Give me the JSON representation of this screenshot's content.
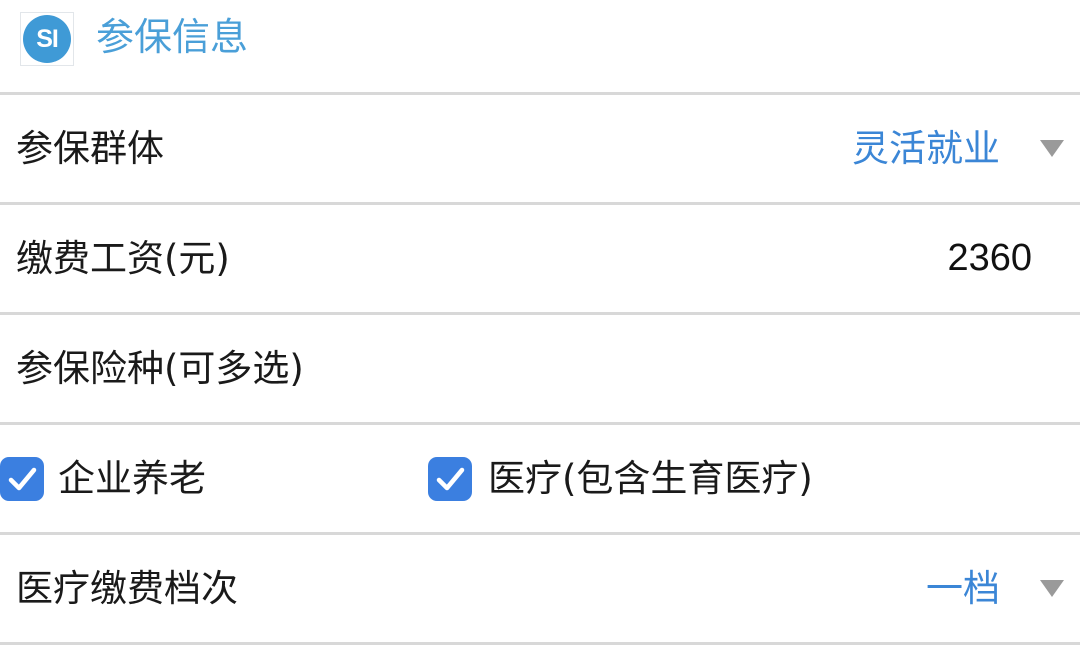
{
  "header": {
    "logo_text": "SI",
    "title": "参保信息"
  },
  "insured_group": {
    "label": "参保群体",
    "value": "灵活就业",
    "icon": "triangle-down-icon"
  },
  "wage": {
    "label": "缴费工资(元)",
    "value": "2360"
  },
  "insurance_types": {
    "label": "参保险种(可多选)",
    "options": [
      {
        "label": "企业养老",
        "checked": true
      },
      {
        "label": "医疗(包含生育医疗)",
        "checked": true
      }
    ]
  },
  "medical_tier": {
    "label": "医疗缴费档次",
    "value": "一档",
    "icon": "triangle-down-icon"
  },
  "colors": {
    "accent_blue": "#3b86d6",
    "header_blue": "#4a9fd8",
    "checkbox_blue": "#3b7fe0",
    "divider_gray": "#d8d8d8",
    "arrow_gray": "#9a9a9a"
  }
}
